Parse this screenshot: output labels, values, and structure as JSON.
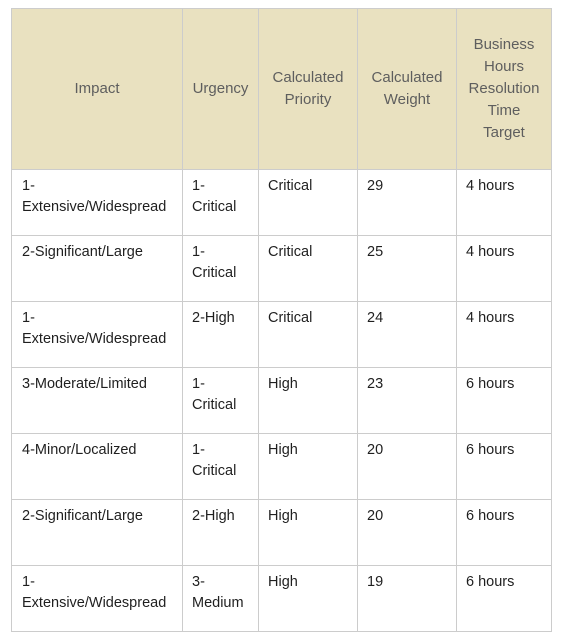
{
  "table": {
    "name": "impact-urgency-priority-matrix",
    "header_background": "#e9e1c0",
    "header_text_color": "#5e5e5e",
    "body_text_color": "#1f1f1f",
    "border_color": "#cccccc",
    "columns": [
      {
        "key": "impact",
        "label": "Impact"
      },
      {
        "key": "urgency",
        "label": "Urgency"
      },
      {
        "key": "priority",
        "label": "Calculated Priority"
      },
      {
        "key": "weight",
        "label": "Calculated Weight"
      },
      {
        "key": "target",
        "label": "Business Hours Resolution Time Target"
      }
    ],
    "header_lines": {
      "impact": [
        "Impact"
      ],
      "urgency": [
        "Urgency"
      ],
      "priority": [
        "Calculated",
        "Priority"
      ],
      "weight": [
        "Calculated",
        "Weight"
      ],
      "target": [
        "Business",
        "Hours",
        "Resolution",
        "Time",
        "Target"
      ]
    },
    "rows": [
      {
        "impact": "1-Extensive/Widespread",
        "urgency": "1-Critical",
        "priority": "Critical",
        "weight": "29",
        "target": "4 hours"
      },
      {
        "impact": "2-Significant/Large",
        "urgency": "1-Critical",
        "priority": "Critical",
        "weight": "25",
        "target": "4 hours"
      },
      {
        "impact": "1-Extensive/Widespread",
        "urgency": "2-High",
        "priority": "Critical",
        "weight": "24",
        "target": "4 hours"
      },
      {
        "impact": "3-Moderate/Limited",
        "urgency": "1-Critical",
        "priority": "High",
        "weight": "23",
        "target": "6 hours"
      },
      {
        "impact": "4-Minor/Localized",
        "urgency": "1-Critical",
        "priority": "High",
        "weight": "20",
        "target": "6 hours"
      },
      {
        "impact": "2-Significant/Large",
        "urgency": "2-High",
        "priority": "High",
        "weight": "20",
        "target": "6 hours"
      },
      {
        "impact": "1-Extensive/Widespread",
        "urgency": "3-Medium",
        "priority": "High",
        "weight": "19",
        "target": "6 hours"
      }
    ]
  }
}
